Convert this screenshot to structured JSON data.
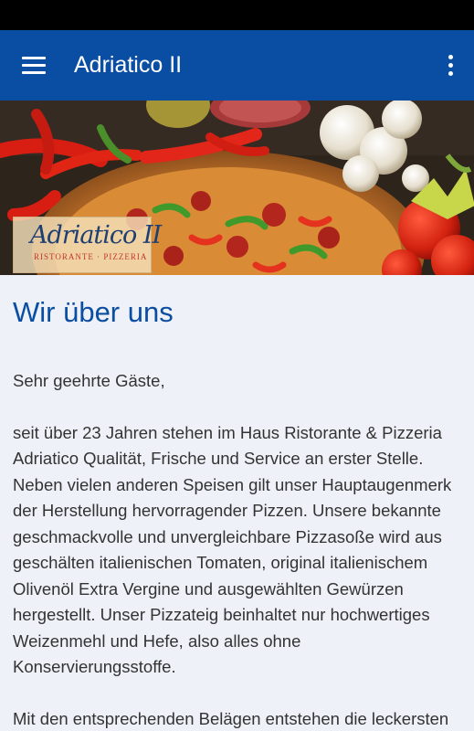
{
  "app_bar": {
    "title": "Adriatico II",
    "menu_icon": "hamburger-menu-icon",
    "more_icon": "more-vert-icon",
    "color": "#0a4ea3"
  },
  "hero": {
    "logo_script": "Adriatico II",
    "logo_sub": "RISTORANTE · PIZZERIA"
  },
  "content": {
    "title": "Wir über uns",
    "greeting": "Sehr geehrte Gäste,",
    "paragraph1": "seit über 23 Jahren stehen im Haus Ristorante & Pizzeria Adriatico Qualität, Frische und Service an erster Stelle. Neben vielen anderen Speisen gilt unser Hauptaugenmerk der Herstellung hervorragender Pizzen. Unsere bekannte geschmackvolle und unvergleichbare Pizzasoße wird aus geschälten italienischen Tomaten, original italienischem Olivenöl Extra Vergine und ausgewählten Gewürzen hergestellt. Unser Pizzateig beinhaltet nur hochwertiges Weizenmehl und Hefe, also alles ohne Konservierungsstoffe.",
    "paragraph2": "Mit den entsprechenden Belägen entstehen die leckersten"
  }
}
